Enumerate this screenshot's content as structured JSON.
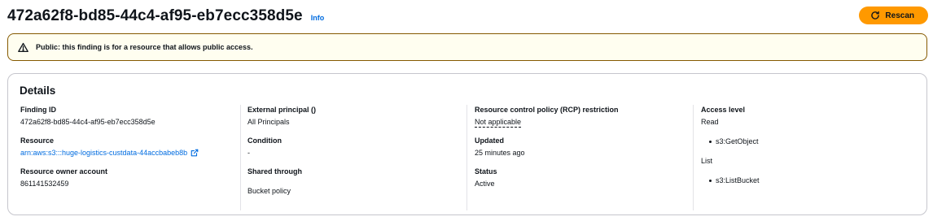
{
  "header": {
    "title": "472a62f8-bd85-44c4-af95-eb7ecc358d5e",
    "info_label": "Info",
    "rescan_label": "Rescan"
  },
  "alert": {
    "text": "Public: this finding is for a resource that allows public access."
  },
  "details": {
    "title": "Details",
    "finding_id": {
      "label": "Finding ID",
      "value": "472a62f8-bd85-44c4-af95-eb7ecc358d5e"
    },
    "resource": {
      "label": "Resource",
      "value": "arn:aws:s3:::huge-logistics-custdata-44accbabeb8b"
    },
    "owner_account": {
      "label": "Resource owner account",
      "value": "861141532459"
    },
    "external_principal": {
      "label": "External principal ()",
      "value": "All Principals"
    },
    "condition": {
      "label": "Condition",
      "value": "-"
    },
    "shared_through": {
      "label": "Shared through",
      "value": "Bucket policy"
    },
    "rcp_restriction": {
      "label": "Resource control policy (RCP) restriction",
      "value": "Not applicable"
    },
    "updated": {
      "label": "Updated",
      "value": "25 minutes ago"
    },
    "status": {
      "label": "Status",
      "value": "Active"
    },
    "access_level": {
      "label": "Access level",
      "groups": [
        {
          "name": "Read",
          "actions": [
            "s3:GetObject"
          ]
        },
        {
          "name": "List",
          "actions": [
            "s3:ListBucket"
          ]
        }
      ]
    }
  },
  "colors": {
    "accent_orange": "#ff9900",
    "link_blue": "#006ce0",
    "warning_border": "#855900",
    "warning_bg": "#fffef0"
  }
}
